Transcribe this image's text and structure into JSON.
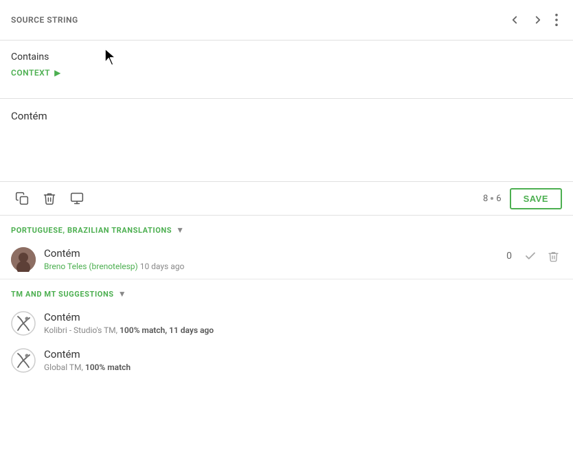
{
  "header": {
    "title": "SOURCE STRING",
    "nav_back_label": "back",
    "nav_forward_label": "forward",
    "more_label": "more options"
  },
  "source": {
    "contains_label": "Contains",
    "context_label": "CONTEXT"
  },
  "translation": {
    "text": "Contém"
  },
  "toolbar": {
    "copy_btn_label": "copy source",
    "delete_btn_label": "delete",
    "special_chars_label": "special characters",
    "count_current": "8",
    "count_max": "6",
    "save_label": "SAVE"
  },
  "portuguese_section": {
    "heading": "PORTUGUESE, BRAZILIAN TRANSLATIONS",
    "items": [
      {
        "text": "Contém",
        "author": "Breno Teles (brenotelesp)",
        "time_ago": "10 days ago",
        "votes": "0"
      }
    ]
  },
  "tm_section": {
    "heading": "TM AND MT SUGGESTIONS",
    "items": [
      {
        "text": "Contém",
        "source": "Kolibri - Studio's TM,",
        "match": "100% match, 11 days ago"
      },
      {
        "text": "Contém",
        "source": "Global TM,",
        "match": "100% match"
      }
    ]
  }
}
